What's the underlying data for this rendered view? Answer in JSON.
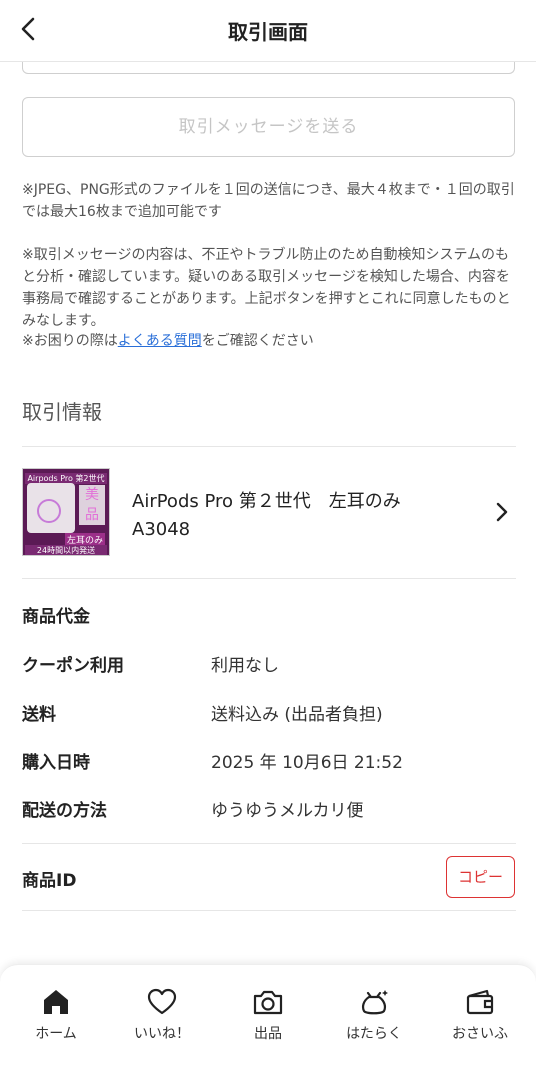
{
  "header": {
    "title": "取引画面"
  },
  "message": {
    "send_label": "取引メッセージを送る"
  },
  "notes": {
    "files": "※JPEG、PNG形式のファイルを１回の送信につき、最大４枚まで・１回の取引では最大16枚まで追加可能です",
    "monitoring": "※取引メッセージの内容は、不正やトラブル防止のため自動検知システムのもと分析・確認しています。疑いのある取引メッセージを検知した場合、内容を事務局で確認することがあります。上記ボタンを押すとこれに同意したものとみなします。",
    "help_prefix": "※お困りの際は",
    "help_link": "よくある質問",
    "help_suffix": "をご確認ください"
  },
  "section": {
    "title": "取引情報"
  },
  "item": {
    "title": "AirPods Pro 第２世代　左耳のみ　A3048",
    "thumb_top": "Airpods Pro 第2世代",
    "thumb_tag": "美品",
    "thumb_left": "左耳のみ",
    "thumb_bottom": "24時間以内発送"
  },
  "info": {
    "price_label": "商品代金",
    "coupon_label": "クーポン利用",
    "coupon_value": "利用なし",
    "shipping_label": "送料",
    "shipping_value": "送料込み (出品者負担)",
    "date_label": "購入日時",
    "date_value": "2025 年 10月6日 21:52",
    "method_label": "配送の方法",
    "method_value": "ゆうゆうメルカリ便",
    "id_label": "商品ID",
    "copy_label": "コピー"
  },
  "tabs": [
    {
      "label": "ホーム",
      "icon": "home-icon"
    },
    {
      "label": "いいね！",
      "icon": "heart-icon"
    },
    {
      "label": "出品",
      "icon": "camera-icon"
    },
    {
      "label": "はたらく",
      "icon": "work-bag-icon"
    },
    {
      "label": "おさいふ",
      "icon": "wallet-icon"
    }
  ],
  "colors": {
    "accent": "#dd3333",
    "link": "#2a6fd8"
  }
}
